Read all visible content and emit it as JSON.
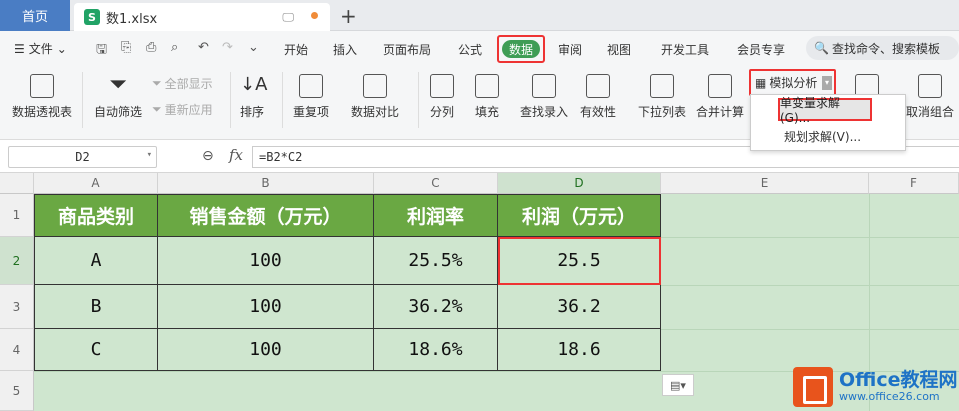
{
  "tabbar": {
    "home": "首页",
    "file_name": "数1.xlsx",
    "file_icon": "S",
    "monitor": "🖵",
    "new_tab": "+"
  },
  "menu": {
    "file": "文件",
    "items": [
      "开始",
      "插入",
      "页面布局",
      "公式",
      "数据",
      "审阅",
      "视图",
      "开发工具",
      "会员专享"
    ],
    "active": "数据",
    "search_placeholder": "查找命令、搜索模板"
  },
  "ribbon": {
    "pivot": "数据透视表",
    "autofilter": "自动筛选",
    "show_all": "全部显示",
    "reapply": "重新应用",
    "sort": "排序",
    "duplicates": "重复项",
    "compare": "数据对比",
    "split": "分列",
    "fill": "填充",
    "lookup": "查找录入",
    "validity": "有效性",
    "dropdown_list": "下拉列表",
    "merge_calc": "合并计算",
    "whatif": "模拟分析",
    "ungroup": "取消组合"
  },
  "dropdown": {
    "goal_seek": "单变量求解(G)...",
    "solver": "规划求解(V)..."
  },
  "formula_bar": {
    "name_box": "D2",
    "formula": "=B2*C2"
  },
  "columns": [
    "A",
    "B",
    "C",
    "D",
    "E",
    "F"
  ],
  "rows": [
    "1",
    "2",
    "3",
    "4",
    "5"
  ],
  "table": {
    "headers": [
      "商品类别",
      "销售金额（万元）",
      "利润率",
      "利润（万元）"
    ],
    "data": [
      [
        "A",
        "100",
        "25.5%",
        "25.5"
      ],
      [
        "B",
        "100",
        "36.2%",
        "36.2"
      ],
      [
        "C",
        "100",
        "18.6%",
        "18.6"
      ]
    ]
  },
  "watermark": {
    "brand": "Office教程网",
    "url": "www.office26.com"
  },
  "colors": {
    "header_green": "#6aa843",
    "data_green": "#cfe6cf",
    "highlight_red": "#ee3333",
    "active_tab": "#3f9d55"
  }
}
